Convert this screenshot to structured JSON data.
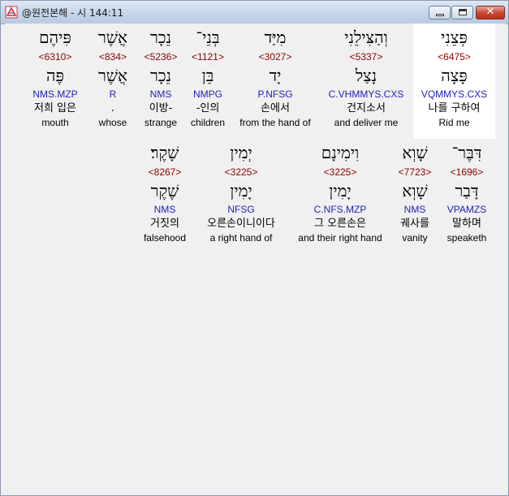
{
  "window": {
    "title": "@원전본해 - 시 144:11",
    "icon": "app-logo-icon",
    "minimize_icon": "minimize-icon",
    "maximize_icon": "maximize-icon",
    "close_icon": "close-icon"
  },
  "rows": [
    {
      "words": [
        {
          "hebrew": "פִּיהֶם",
          "strong": "<6310>",
          "lemma": "פֶּה",
          "morph": "NMS.MZP",
          "korean": "저희 입은",
          "english": "mouth",
          "selected": false
        },
        {
          "hebrew": "אֲשֶׁר",
          "strong": "<834>",
          "lemma": "אֲשֶׁר",
          "morph": "R",
          "korean": ".",
          "english": "whose",
          "selected": false
        },
        {
          "hebrew": "נֵכָר",
          "strong": "<5236>",
          "lemma": "נֵכָר",
          "morph": "NMS",
          "korean": "이방-",
          "english": "strange",
          "selected": false
        },
        {
          "hebrew": "בְּנֵי־",
          "strong": "<1121>",
          "lemma": "בֵּן",
          "morph": "NMPG",
          "korean": "-인의",
          "english": "children",
          "selected": false
        },
        {
          "hebrew": "מִיַּד",
          "strong": "<3027>",
          "lemma": "יָד",
          "morph": "P.NFSG",
          "korean": "손에서",
          "english": "from the hand of",
          "selected": false
        },
        {
          "hebrew": "וְהַצִּילֵנִי",
          "strong": "<5337>",
          "lemma": "נָצַל",
          "morph": "C.VHMMYS.CXS",
          "korean": "건지소서",
          "english": "and deliver me",
          "selected": false
        },
        {
          "hebrew": "פְּצֵנִי",
          "strong": "<6475>",
          "lemma": "פָּצָה",
          "morph": "VQMMYS.CXS",
          "korean": "나를 구하여",
          "english": "Rid me",
          "selected": true
        }
      ]
    },
    {
      "words": [
        {
          "hebrew": "שָׁקֶר׃",
          "strong": "<8267>",
          "lemma": "שֶׁקֶר",
          "morph": "NMS",
          "korean": "거짓의",
          "english": "falsehood",
          "selected": false
        },
        {
          "hebrew": "יְמִין",
          "strong": "<3225>",
          "lemma": "יָמִין",
          "morph": "NFSG",
          "korean": "오른손이니이다",
          "english": "a right hand of",
          "selected": false
        },
        {
          "hebrew": "וִימִינָם",
          "strong": "<3225>",
          "lemma": "יָמִין",
          "morph": "C.NFS.MZP",
          "korean": "그 오른손은",
          "english": "and their right hand",
          "selected": false
        },
        {
          "hebrew": "שָׁוְא",
          "strong": "<7723>",
          "lemma": "שָׁוְא",
          "morph": "NMS",
          "korean": "궤사를",
          "english": "vanity",
          "selected": false
        },
        {
          "hebrew": "דִּבֶּר־",
          "strong": "<1696>",
          "lemma": "דָּבַר",
          "morph": "VPAMZS",
          "korean": "말하며",
          "english": "speaketh",
          "selected": false
        }
      ]
    }
  ]
}
